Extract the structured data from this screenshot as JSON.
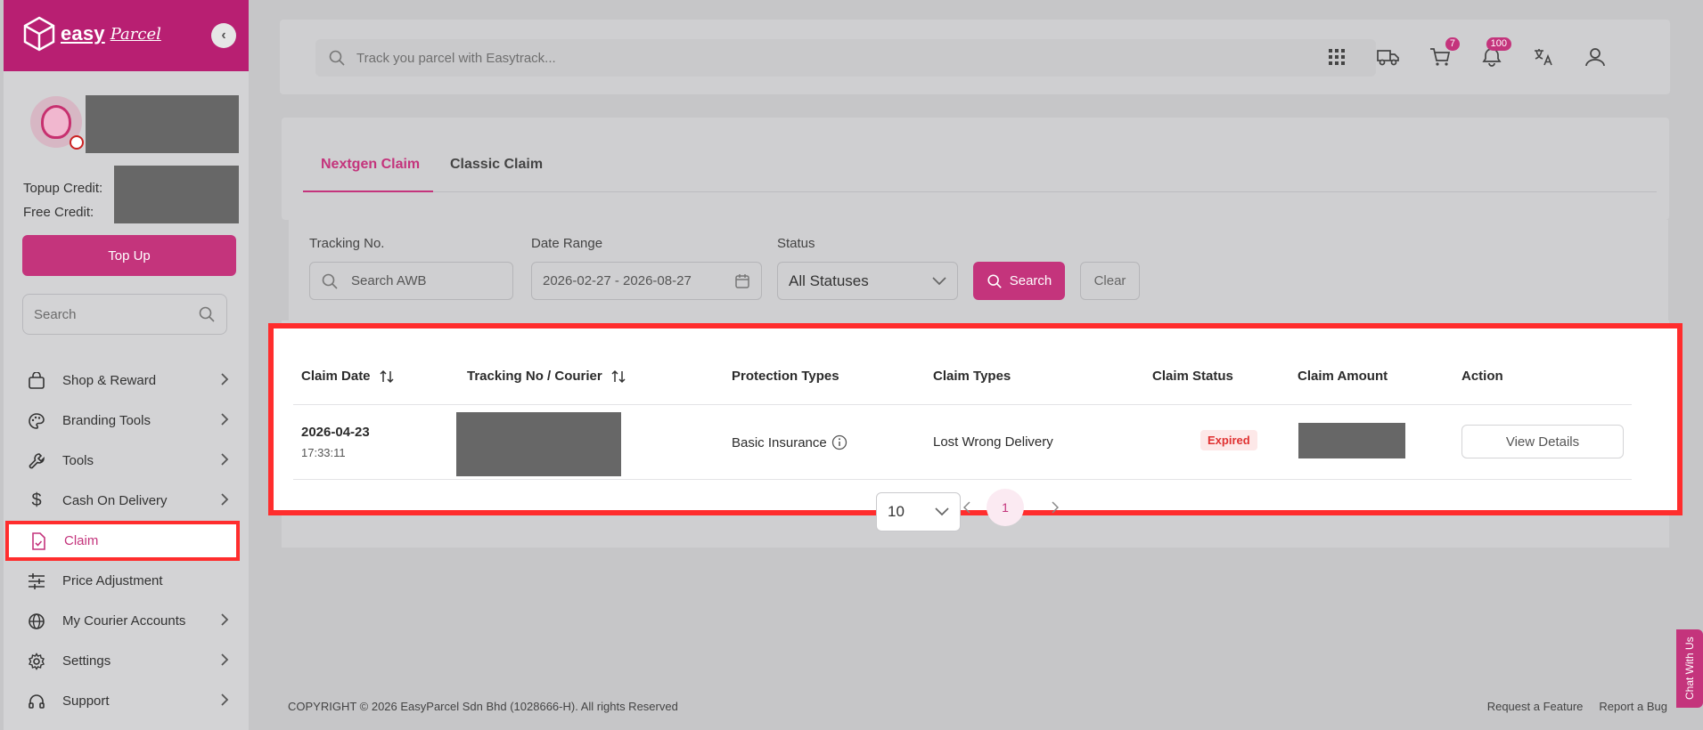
{
  "brand": {
    "name": "easy",
    "script": "Parcel",
    "collapse_icon": "chevron-left-icon"
  },
  "sidebar": {
    "credit_labels": {
      "topup": "Topup Credit:",
      "free": "Free Credit:"
    },
    "topup_label": "Top Up",
    "search_placeholder": "Search",
    "items": [
      {
        "label": "Shop & Reward",
        "icon": "shopping-bag-icon",
        "has_chevron": true
      },
      {
        "label": "Branding Tools",
        "icon": "palette-icon",
        "has_chevron": true
      },
      {
        "label": "Tools",
        "icon": "wrench-icon",
        "has_chevron": true
      },
      {
        "label": "Cash On Delivery",
        "icon": "dollar-icon",
        "has_chevron": true
      },
      {
        "label": "Claim",
        "icon": "claim-doc-icon",
        "has_chevron": false,
        "active": true
      },
      {
        "label": "Price Adjustment",
        "icon": "sliders-icon",
        "has_chevron": false
      },
      {
        "label": "My Courier Accounts",
        "icon": "globe-icon",
        "has_chevron": true
      },
      {
        "label": "Settings",
        "icon": "gear-icon",
        "has_chevron": true
      },
      {
        "label": "Support",
        "icon": "headset-icon",
        "has_chevron": true
      }
    ]
  },
  "topbar": {
    "track_placeholder": "Track you parcel with Easytrack...",
    "cart_badge": "7",
    "notification_badge": "100"
  },
  "tabs": [
    {
      "label": "Nextgen Claim",
      "active": true
    },
    {
      "label": "Classic Claim",
      "active": false
    }
  ],
  "filters": {
    "tracking_label": "Tracking No.",
    "tracking_placeholder": "Search AWB",
    "date_label": "Date Range",
    "date_value": "2026-02-27 - 2026-08-27",
    "status_label": "Status",
    "status_value": "All Statuses",
    "search_label": "Search",
    "clear_label": "Clear"
  },
  "table": {
    "headers": [
      "Claim Date",
      "Tracking No / Courier",
      "Protection Types",
      "Claim Types",
      "Claim Status",
      "Claim Amount",
      "Action"
    ],
    "rows": [
      {
        "date": "2026-04-23",
        "time": "17:33:11",
        "protection": "Basic Insurance",
        "claim_type": "Lost Wrong Delivery",
        "status": "Expired",
        "action": "View Details"
      }
    ]
  },
  "pager": {
    "page_size": "10",
    "current_page": "1"
  },
  "footer": {
    "copyright": "COPYRIGHT © 2026 EasyParcel Sdn Bhd (1028666-H). All rights Reserved",
    "request_feature": "Request a Feature",
    "report_bug": "Report a Bug",
    "chat": "Chat With Us"
  },
  "colors": {
    "brand": "#b81f72",
    "accent": "#c4347c",
    "highlight": "#ff2d2d",
    "status_expired": "#e03131"
  }
}
